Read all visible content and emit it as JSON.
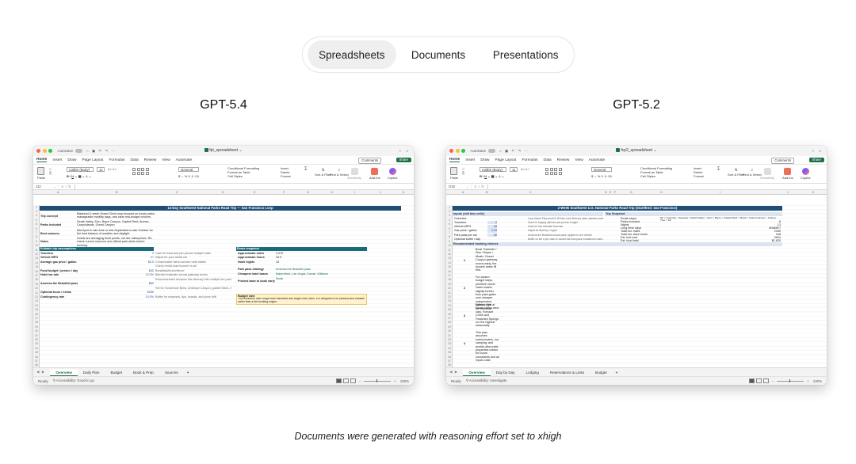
{
  "tabs": [
    "Spreadsheets",
    "Documents",
    "Presentations"
  ],
  "caption": "Documents were generated with reasoning effort set to xhigh",
  "colors": {
    "excel_green": "#1e7145",
    "title_band": "#1f4e79",
    "teal_band": "#1b6b7a",
    "light_band": "#dbe4f0",
    "note_yellow": "#fff2cc"
  },
  "left": {
    "model": "GPT-5.4",
    "titlebar": {
      "autosave": "AutoSave",
      "file": "fpt_spreadsheet"
    },
    "menu": [
      "Home",
      "Insert",
      "Draw",
      "Page Layout",
      "Formulas",
      "Data",
      "Review",
      "View",
      "Automate"
    ],
    "comments": "Comments",
    "share": "Share",
    "ribbon": {
      "paste": "Paste",
      "font": "Calibri (Body)",
      "size": "11",
      "number_format": "General",
      "cond": "Conditional Formatting",
      "fmt_table": "Format as Table",
      "cell_styles": "Cell Styles",
      "insert": "Insert",
      "delete": "Delete",
      "format": "Format",
      "sort": "Sort & Filter",
      "find": "Find & Select",
      "sensitivity": "Sensitivity",
      "addins": "Add-ins",
      "copilot": "Copilot"
    },
    "namebox": "J12",
    "cols": [
      "A",
      "B",
      "C",
      "D",
      "E",
      "F",
      "G",
      "H",
      "I",
      "J",
      "K"
    ],
    "title": "14-Day Southwest National Parks Road Trip — San Francisco Loop",
    "intro": [
      {
        "label": "Trip concept",
        "text": "Balanced 2-week Grand Circle loop focused on iconic parks, manageable mobility days, and clear mid-budget choices."
      },
      {
        "label": "Parks included",
        "text": "Death Valley, Zion, Bryce Canyon, Capitol Reef, Arches, Canyonlands, Grand Canyon"
      },
      {
        "label": "Best seasons",
        "text": "Mid-April to mid-June or mid-September to late October for the best balance of weather and daylight."
      },
      {
        "label": "Notes",
        "text": "Hotels are averaging fixed points, not live rates/prices. Re-check current reserves and official park alerts before booking."
      }
    ],
    "assump_header": "Editable trip assumptions",
    "assumptions": [
      {
        "label": "Travelers",
        "value": "2",
        "note": "Used for food and per-person budget math"
      },
      {
        "label": "Vehicle MPG",
        "value": "27",
        "note": "Adjust for your rental car"
      },
      {
        "label": "Average gas price / gallon",
        "value": "$4.5",
        "note": "Conservative blend across route states"
      },
      {
        "label": "",
        "value": "",
        "note": "Check rental-road income vs all"
      },
      {
        "label": "Food budget / person / day",
        "value": "$45",
        "note": "Breakfast/lunch/dinner"
      },
      {
        "label": "Hotel tax rate",
        "value": "12.0%",
        "note": "Blended estimate across gateway towns"
      },
      {
        "label": "",
        "value": "",
        "note": "Recommended because this itinerary hits multiple fee parks"
      },
      {
        "label": "America the Beautiful pass",
        "value": "$80",
        "note": ""
      },
      {
        "label": "",
        "value": "",
        "note": "Set for Horseshoe Bend, Antelope Canyon, guided hikes, etc."
      },
      {
        "label": "Optional tours / extras",
        "value": "$250",
        "note": ""
      },
      {
        "label": "Contingency rate",
        "value": "10.0%",
        "note": "Buffer for surprises, tips, snacks, and price drift"
      }
    ],
    "route_header": "Route snapshot",
    "route": [
      {
        "label": "Approximate miles",
        "value": "2,070"
      },
      {
        "label": "Approximate hours",
        "value": "34.5"
      },
      {
        "label": "Hotel nights",
        "value": "13"
      },
      {
        "label": "Park pass strategy",
        "value": "America the Beautiful pass"
      },
      {
        "label": "Cheapest hotel bases",
        "value": "Bakersfield, Las Vegas, Kanab, Williams"
      },
      {
        "label": "Priciest base to book early",
        "value": "Moab"
      }
    ],
    "note_header": "Budget note",
    "note_text": "This workbook uses rough hotel estimates and target room rates. It is designed to be practical and editable rather than a live booking engine.",
    "sheets": [
      "Overview",
      "Daily Plan",
      "Budget",
      "Book & Prep",
      "Sources"
    ],
    "active_sheet": "Overview",
    "status": {
      "ready": "Ready",
      "accessibility": "Accessibility: Good to go",
      "zoom": "100%"
    }
  },
  "right": {
    "model": "GPT-5.2",
    "titlebar": {
      "autosave": "AutoSave",
      "file": "fcp2_spreadsheet"
    },
    "menu": [
      "Home",
      "Insert",
      "Draw",
      "Page Layout",
      "Formulas",
      "Data",
      "Review",
      "View",
      "Automate"
    ],
    "comments": "Comments",
    "share": "Share",
    "ribbon": {
      "paste": "Paste",
      "font": "Calibri (Body)",
      "size": "11",
      "number_format": "General",
      "cond": "Conditional Formatting",
      "fmt_table": "Format as Table",
      "cell_styles": "Cell Styles",
      "insert": "Insert",
      "delete": "Delete",
      "format": "Format",
      "sort": "Sort & Filter",
      "find": "Find & Select",
      "sensitivity": "Sensitivity",
      "addins": "Add-ins",
      "copilot": "Copilot"
    },
    "namebox": "G15",
    "cols": [
      "A",
      "B",
      "C",
      "D",
      "E",
      "F",
      "G",
      "H",
      "I",
      "J",
      "K"
    ],
    "title": "2-Week Southwest U.S. National Parks Road Trip (Start/End: San Francisco)",
    "inputs_header": "Inputs (edit blue cells)",
    "inputs": [
      {
        "label": "Overview",
        "value": "",
        "note": "Loop Monte Pisa south to fill blue-zone itinerary data; updates automatically."
      },
      {
        "label": "Travelers",
        "value": "2",
        "note": "Used for lodging split and per-person budget"
      },
      {
        "label": "Vehicle MPG",
        "value": "28",
        "note": "Used for fuel estimate formulas"
      },
      {
        "label": "Gas price / gallon",
        "value": "4.25",
        "note": "Adjust for itinerary / region"
      },
      {
        "label": "Park pass per car",
        "value": "80",
        "note": "America the Beautiful annual pass; applies to one vehicle"
      },
      {
        "label": "Optional buffer / day",
        "value": "",
        "note": "Buffer on the # per case or cancel-the-blue-pass in balanced costs / check ins"
      }
    ],
    "snapshot_header": "Trip Snapshot",
    "snapshot": [
      {
        "label": "Route stops",
        "value": "SF > Yosemite > Sequoia > Death Valley > Zion > Bryce > Capitol Reef > Moab > Grand Canyon > Joshua Tree > SF"
      },
      {
        "label": "Parks included",
        "value": "8"
      },
      {
        "label": "Nights",
        "value": "13"
      },
      {
        "label": "Long drive days",
        "value": "#NAME?"
      },
      {
        "label": "Total est. miles",
        "value": "2150"
      },
      {
        "label": "Total est. drive hours",
        "value": "248"
      },
      {
        "label": "Est. fuel cost",
        "value": "3904"
      },
      {
        "label": "Est. food total",
        "value": "$1,620"
      }
    ],
    "booking_header": "Recommended booking choices",
    "booking": [
      {
        "n": "1",
        "text": "Book Yosemite / Zion / Bryce / Moab / Grand Canyon gateway rooms early; the busiest dates fill first."
      },
      {
        "n": "2",
        "text": "For clearer budget stays, prioritize newer chain motels slightly further from park gates over cheaper independent options right at the entrance."
      },
      {
        "n": "3",
        "text": "Rates in the Death Valley area vary, Furnace Creek and Panamint Springs run the highest seasonally."
      },
      {
        "n": "4",
        "text": "This plan assumes hotels/motels, not camping; and avoids ultra-rustic properties unless fee travel constraints and all inputs valid."
      }
    ],
    "sheets": [
      "Overview",
      "Day by Day",
      "Lodging",
      "Reservations & Links",
      "Budget"
    ],
    "active_sheet": "Overview",
    "status": {
      "ready": "Ready",
      "accessibility": "Accessibility: Investigate",
      "zoom": "100%"
    }
  }
}
